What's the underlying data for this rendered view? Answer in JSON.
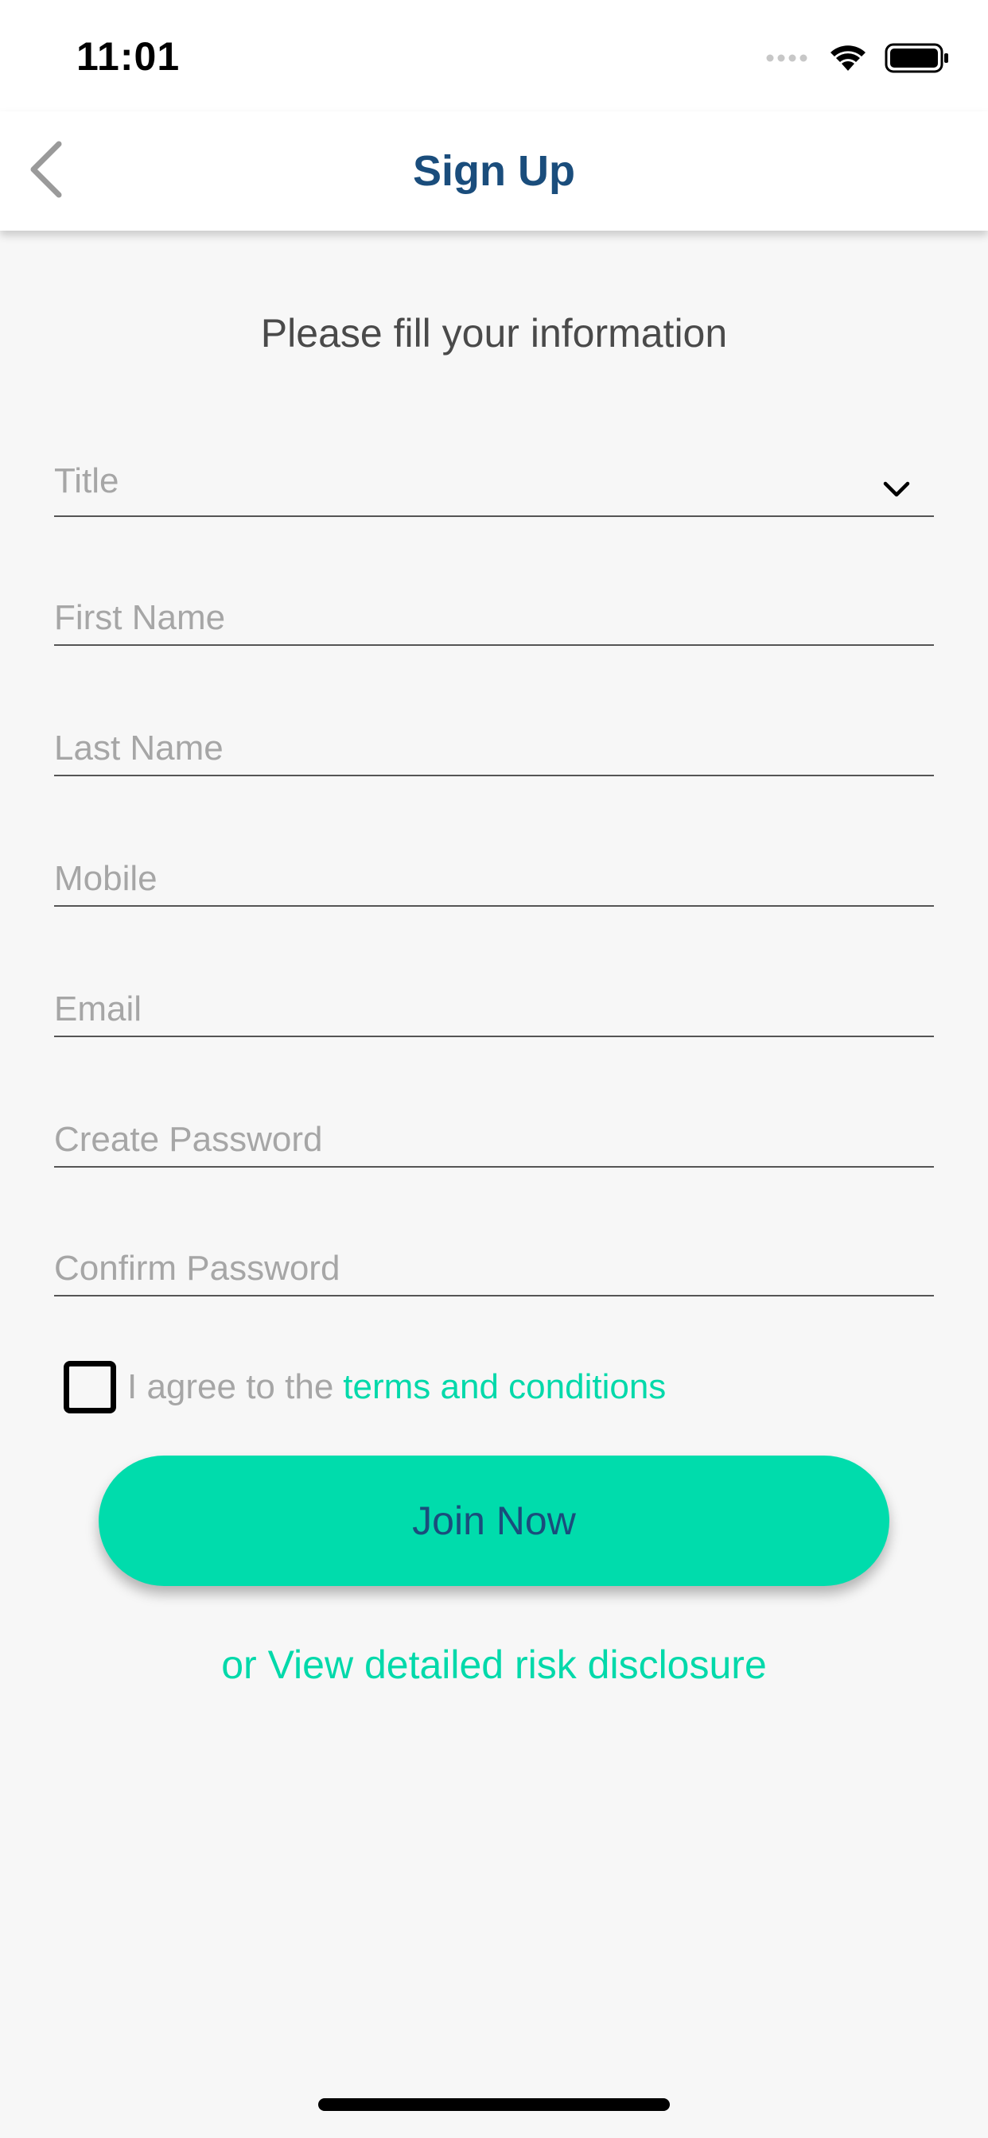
{
  "status_bar": {
    "time": "11:01"
  },
  "nav": {
    "title": "Sign Up",
    "back_icon": "chevron-left-icon"
  },
  "form": {
    "subtitle": "Please fill your information",
    "title_select": {
      "placeholder": "Title",
      "icon": "chevron-down-icon"
    },
    "first_name": {
      "placeholder": "First Name",
      "value": ""
    },
    "last_name": {
      "placeholder": "Last Name",
      "value": ""
    },
    "mobile": {
      "placeholder": "Mobile",
      "value": ""
    },
    "email": {
      "placeholder": "Email",
      "value": ""
    },
    "create_password": {
      "placeholder": "Create Password",
      "value": ""
    },
    "confirm_password": {
      "placeholder": "Confirm Password",
      "value": ""
    },
    "terms": {
      "checked": false,
      "prefix": "I agree to the",
      "link": "terms and conditions"
    },
    "join_button": "Join Now",
    "risk_link": "or View detailed risk disclosure"
  },
  "colors": {
    "nav_title": "#1a4d7c",
    "accent": "#00dcac",
    "link": "#00d9aa",
    "background": "#f7f7f7"
  }
}
